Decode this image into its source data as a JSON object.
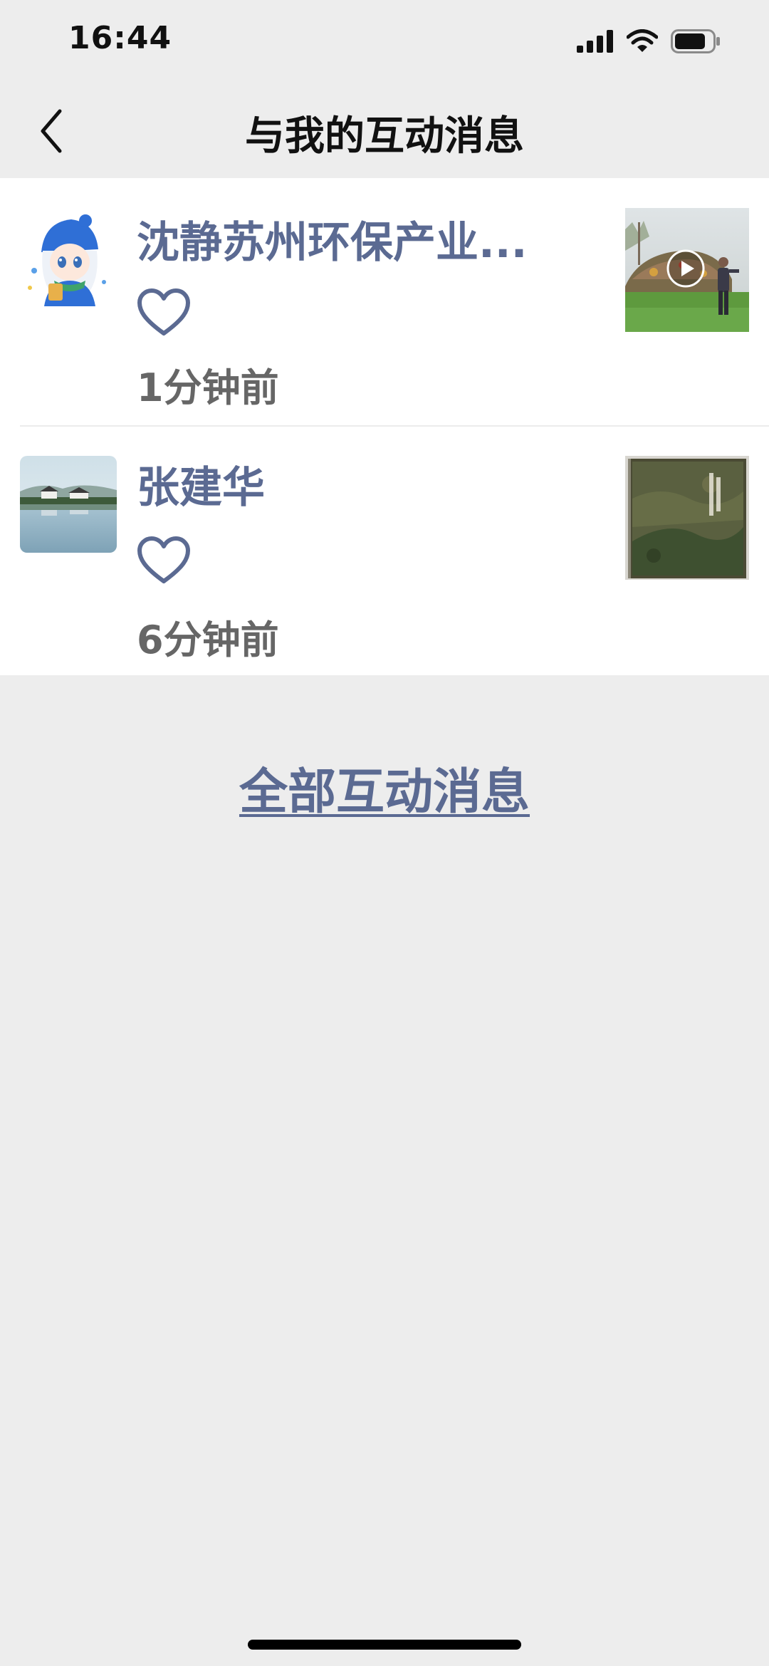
{
  "status_bar": {
    "time": "16:44",
    "icons": [
      "cellular-signal-icon",
      "wifi-icon",
      "battery-icon"
    ]
  },
  "nav": {
    "back_icon": "chevron-left-icon",
    "title": "与我的互动消息"
  },
  "messages": [
    {
      "name": "沈静苏州环保产业...",
      "interaction_icon": "heart-icon",
      "time": "1分钟前",
      "thumbnail": "video",
      "thumbnail_badge": "play-icon"
    },
    {
      "name": "张建华",
      "interaction_icon": "heart-icon",
      "time": "6分钟前",
      "thumbnail": "image"
    }
  ],
  "all_link": "全部互动消息",
  "colors": {
    "background": "#ededed",
    "card": "#ffffff",
    "name": "#5b6a92",
    "time": "#666666",
    "link": "#5b6a92"
  }
}
